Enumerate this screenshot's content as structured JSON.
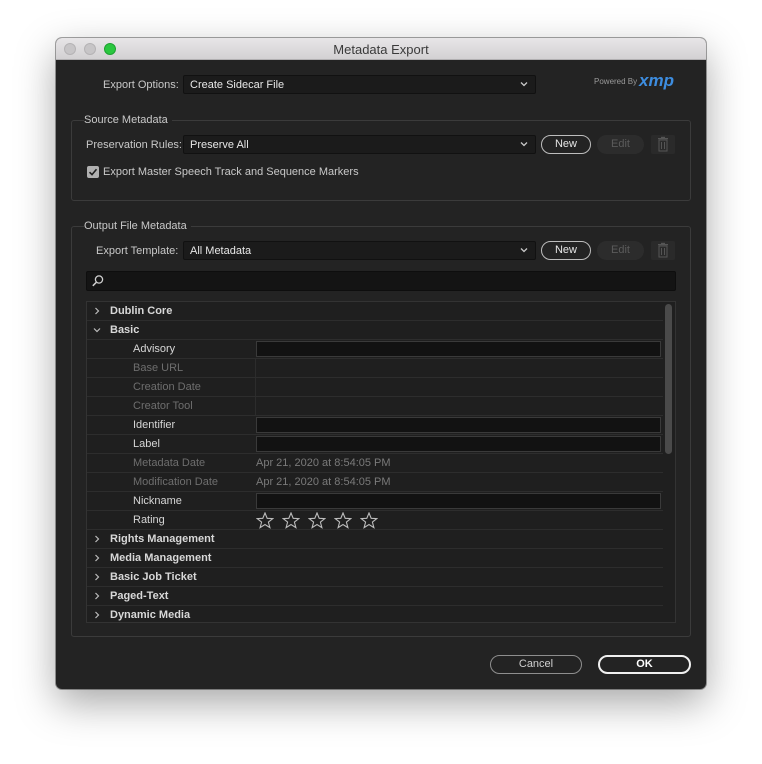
{
  "window": {
    "title": "Metadata Export"
  },
  "export_options": {
    "label": "Export Options:",
    "value": "Create Sidecar File"
  },
  "branding": {
    "powered_by": "Powered By",
    "logo_text": "xmp",
    "logo_color": "#3d8de0"
  },
  "source_metadata": {
    "title": "Source Metadata",
    "preservation_label": "Preservation Rules:",
    "preservation_value": "Preserve All",
    "new_label": "New",
    "edit_label": "Edit",
    "checkbox_label": "Export Master Speech Track and Sequence Markers",
    "checkbox_checked": true
  },
  "output_metadata": {
    "title": "Output File Metadata",
    "template_label": "Export Template:",
    "template_value": "All Metadata",
    "new_label": "New",
    "edit_label": "Edit",
    "search_value": ""
  },
  "tree": {
    "categories": {
      "dublin_core": "Dublin Core",
      "basic": "Basic",
      "rights_management": "Rights Management",
      "media_management": "Media Management",
      "basic_job_ticket": "Basic Job Ticket",
      "paged_text": "Paged-Text",
      "dynamic_media": "Dynamic Media"
    },
    "basic_fields": {
      "advisory": {
        "label": "Advisory",
        "value": ""
      },
      "base_url": {
        "label": "Base URL",
        "value": ""
      },
      "creation_date": {
        "label": "Creation Date",
        "value": ""
      },
      "creator_tool": {
        "label": "Creator Tool",
        "value": ""
      },
      "identifier": {
        "label": "Identifier",
        "value": ""
      },
      "label": {
        "label": "Label",
        "value": ""
      },
      "metadata_date": {
        "label": "Metadata Date",
        "value": "Apr 21, 2020 at 8:54:05 PM"
      },
      "modification_date": {
        "label": "Modification Date",
        "value": "Apr 21, 2020 at 8:54:05 PM"
      },
      "nickname": {
        "label": "Nickname",
        "value": ""
      },
      "rating": {
        "label": "Rating",
        "value": 0,
        "max": 5
      }
    }
  },
  "footer": {
    "cancel_label": "Cancel",
    "ok_label": "OK"
  }
}
